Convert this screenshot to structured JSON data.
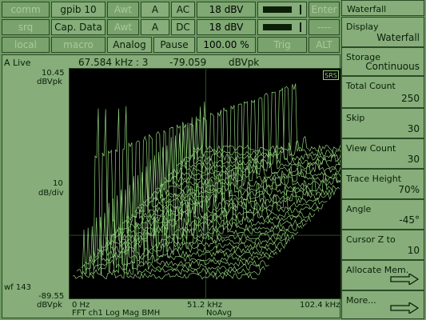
{
  "top_row1": {
    "comm": "comm",
    "gpib": "gpib 10",
    "awt1": "Awt",
    "ch_a1": "A",
    "ac": "AC",
    "level1": "18 dBV",
    "enter": "Enter"
  },
  "top_row2": {
    "srq": "srq",
    "cap": "Cap. Data",
    "awt2": "Awt",
    "ch_a2": "A",
    "dc": "DC",
    "level2": "18 dBV",
    "dash": "----"
  },
  "top_row3": {
    "local": "local",
    "macro": "macro",
    "analog": "Analog",
    "pause": "Pause",
    "percent": "100.00 %",
    "trig": "Trig",
    "alt": "ALT"
  },
  "graph": {
    "status": "A Live",
    "readout_freq": "67.584 kHz : 3",
    "readout_val": "-79.059",
    "readout_unit": "dBVpk",
    "top_ref": "10.45",
    "top_unit": "dBVpk",
    "scale": "10",
    "scale_unit": "dB/div",
    "wf": "wf 143",
    "bottom_ref": "-89.55",
    "bottom_unit": "dBVpk",
    "x_start": "0 Hz",
    "x_mid": "51.2 kHz",
    "x_end": "102.4 kHz",
    "trace_info": "FFT ch1 Log Mag BMH",
    "avg": "NoAvg",
    "logo": "SRS"
  },
  "menu": {
    "title": "Waterfall",
    "items": [
      {
        "label": "Display",
        "value": "Waterfall"
      },
      {
        "label": "Storage",
        "value": "Continuous"
      },
      {
        "label": "Total Count",
        "value": "250"
      },
      {
        "label": "Skip",
        "value": "30"
      },
      {
        "label": "View Count",
        "value": "30"
      },
      {
        "label": "Trace Height",
        "value": "70%"
      },
      {
        "label": "Angle",
        "value": "-45°"
      },
      {
        "label": "Cursor Z to",
        "value": "10"
      },
      {
        "label": "Allocate Mem.",
        "value": ""
      },
      {
        "label": "More...",
        "value": ""
      }
    ]
  },
  "colors": {
    "trace": "#8fd07a",
    "bg": "#000000",
    "panel": "#86ad7a"
  },
  "waterfall": {
    "traces": 30,
    "angle_deg": -45,
    "height_pct": 70
  }
}
